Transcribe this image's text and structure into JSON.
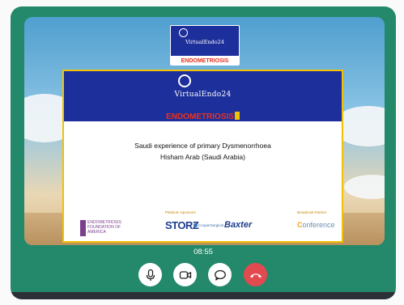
{
  "thumbnail": {
    "title": "VirtualEndo24",
    "banner": "ENDOMETRIOSIS"
  },
  "slide": {
    "header_title": "VirtualEndo24",
    "banner": "ENDOMETRIOSIS",
    "talk_title": "Saudi experience of primary Dysmenorrhoea",
    "speaker": "Hisham Arab (Saudi Arabia)",
    "platinum_label": "Platinum Sponsors",
    "broadcast_label": "Broadcast Partner",
    "sponsors": {
      "efa": [
        "ENDOMETRIOSIS",
        "FOUNDATION OF",
        "AMERICA"
      ],
      "storz": "STORZ",
      "cooper": "CooperSurgical",
      "baxter": "Baxter",
      "conference_c": "C",
      "conference_rest": "onference"
    }
  },
  "call": {
    "elapsed_time": "08:55"
  },
  "controls": {
    "mic_icon": "microphone-icon",
    "camera_icon": "camera-icon",
    "chat_icon": "chat-bubble-icon",
    "hangup_icon": "phone-hangup-icon",
    "hangup_color": "#e24a4f"
  },
  "theme": {
    "frame_color": "#23896a",
    "slide_header_color": "#1d2f9b",
    "banner_color": "#e8321f",
    "slide_border_color": "#f2c100"
  }
}
